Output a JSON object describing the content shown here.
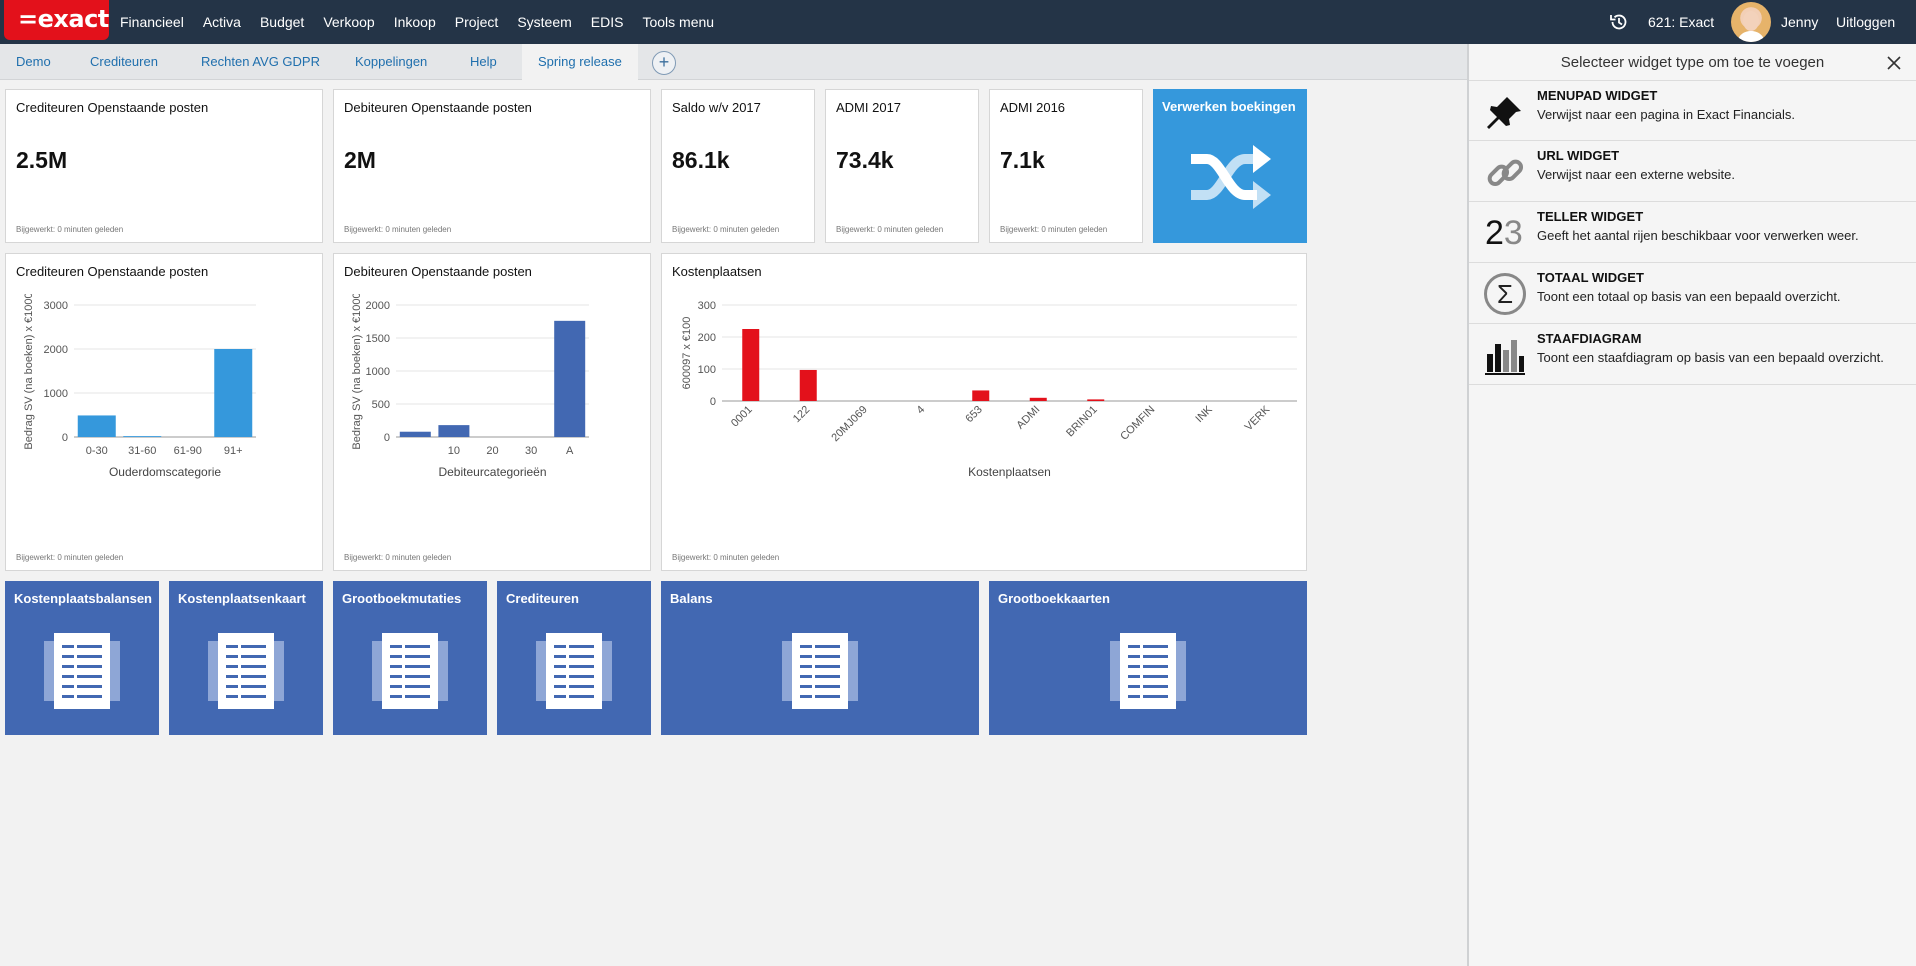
{
  "topbar": {
    "logo": "=exact",
    "menu": [
      "Financieel",
      "Activa",
      "Budget",
      "Verkoop",
      "Inkoop",
      "Project",
      "Systeem",
      "EDIS",
      "Tools menu"
    ],
    "company": "621: Exact",
    "user": "Jenny",
    "logout": "Uitloggen"
  },
  "tabs": [
    "Demo",
    "Crediteuren",
    "Rechten AVG GDPR",
    "Koppelingen",
    "Help",
    "Spring release"
  ],
  "active_tab": "Spring release",
  "kpis": [
    {
      "title": "Crediteuren Openstaande posten",
      "value": "2.5M",
      "updated": "Bijgewerkt: 0 minuten geleden"
    },
    {
      "title": "Debiteuren Openstaande posten",
      "value": "2M",
      "updated": "Bijgewerkt: 0 minuten geleden"
    },
    {
      "title": "Saldo w/v 2017",
      "value": "86.1k",
      "updated": "Bijgewerkt: 0 minuten geleden"
    },
    {
      "title": "ADMI 2017",
      "value": "73.4k",
      "updated": "Bijgewerkt: 0 minuten geleden"
    },
    {
      "title": "ADMI 2016",
      "value": "7.1k",
      "updated": "Bijgewerkt: 0 minuten geleden"
    }
  ],
  "verwerken": {
    "title": "Verwerken boekingen",
    "color": "#3598dc"
  },
  "chart_cards": [
    {
      "title": "Crediteuren Openstaande posten",
      "updated": "Bijgewerkt: 0 minuten geleden"
    },
    {
      "title": "Debiteuren Openstaande posten",
      "updated": "Bijgewerkt: 0 minuten geleden"
    },
    {
      "title": "Kostenplaatsen",
      "updated": "Bijgewerkt: 0 minuten geleden"
    }
  ],
  "chart_data": [
    {
      "type": "bar",
      "title": "",
      "categories": [
        "0-30",
        "31-60",
        "61-90",
        "91+"
      ],
      "values": [
        490,
        20,
        0,
        2000
      ],
      "xlabel": "Ouderdomscategorie",
      "ylabel": "Bedrag SV (na boeken) x €1000",
      "yticks": [
        0,
        1000,
        2000,
        3000
      ],
      "ylim": [
        0,
        3000
      ],
      "color": "#3598dc"
    },
    {
      "type": "bar",
      "title": "",
      "categories": [
        "",
        "10",
        "20",
        "30",
        "A"
      ],
      "values": [
        80,
        180,
        0,
        0,
        1760
      ],
      "xlabel": "Debiteurcategorieën",
      "ylabel": "Bedrag SV (na boeken) x €1000",
      "yticks": [
        0,
        500,
        1000,
        1500,
        2000
      ],
      "ylim": [
        0,
        2000
      ],
      "color": "#4268b2"
    },
    {
      "type": "bar",
      "title": "",
      "categories": [
        "0001",
        "122",
        "20MJ069",
        "4",
        "653",
        "ADMI",
        "BRIN01",
        "COMFIN",
        "INK",
        "VERK"
      ],
      "values": [
        225,
        97,
        0,
        0,
        33,
        10,
        5,
        0,
        0,
        0
      ],
      "xlabel": "Kostenplaatsen",
      "ylabel": "600097 x €100",
      "yticks": [
        0,
        100,
        200,
        300
      ],
      "ylim": [
        0,
        300
      ],
      "color": "#e3111b"
    }
  ],
  "menu_cards": [
    "Kostenplaatsbalansen",
    "Kostenplaatsenkaart",
    "Grootboekmutaties",
    "Crediteuren",
    "Balans",
    "Grootboekkaarten"
  ],
  "panel": {
    "title": "Selecteer widget type om toe te voegen",
    "options": [
      {
        "name": "MENUPAD WIDGET",
        "desc": "Verwijst naar een pagina in Exact Financials.",
        "icon": "pin-icon"
      },
      {
        "name": "URL WIDGET",
        "desc": "Verwijst naar een externe website.",
        "icon": "link-icon"
      },
      {
        "name": "TELLER WIDGET",
        "desc": "Geeft het aantal rijen beschikbaar voor verwerken weer.",
        "icon": "counter-icon",
        "icon_text": [
          "2",
          "3"
        ]
      },
      {
        "name": "TOTAAL WIDGET",
        "desc": "Toont een totaal op basis van een bepaald overzicht.",
        "icon": "sigma-icon",
        "icon_text": [
          "Σ"
        ]
      },
      {
        "name": "STAAFDIAGRAM",
        "desc": "Toont een staafdiagram op basis van een bepaald overzicht.",
        "icon": "bar-chart-icon"
      }
    ]
  }
}
